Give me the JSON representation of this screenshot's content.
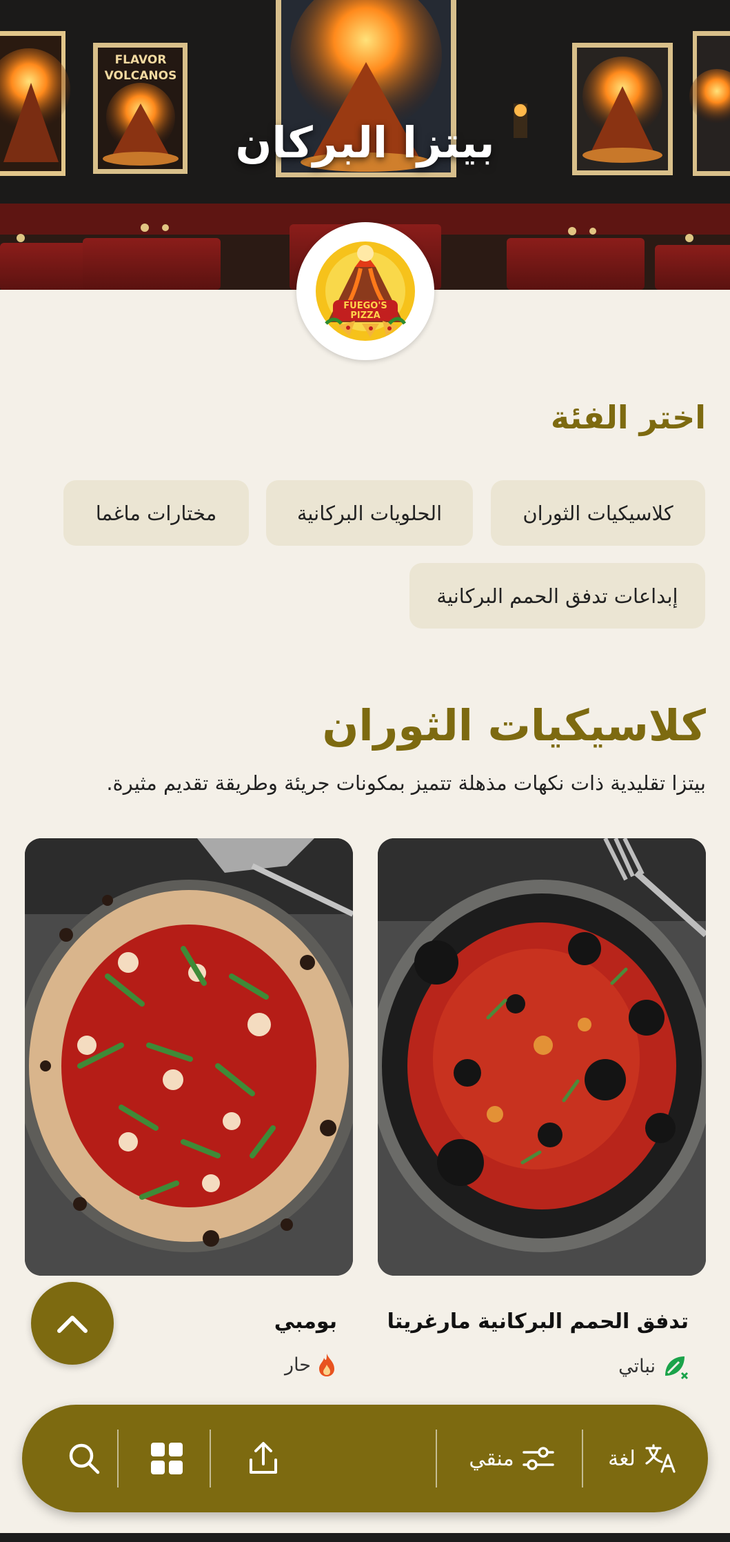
{
  "restaurant": {
    "name": "بيتزا البركان",
    "logo_text": "FUEGO'S PIZZA",
    "poster_text": "FLAVOR VOLCANOS"
  },
  "categories": {
    "heading": "اختر الفئة",
    "items": [
      {
        "label": "كلاسيكيات الثوران"
      },
      {
        "label": "الحلويات البركانية"
      },
      {
        "label": "مختارات ماغما"
      },
      {
        "label": "إبداعات تدفق الحمم البركانية"
      }
    ]
  },
  "section": {
    "title": "كلاسيكيات الثوران",
    "description": "بيتزا تقليدية ذات نكهات مذهلة تتميز بمكونات جريئة وطريقة تقديم مثيرة."
  },
  "products": [
    {
      "name": "تدفق الحمم البركانية مارغريتا",
      "tag": "نباتي",
      "tag_icon": "vegetarian-leaf-icon",
      "tag_color": "#1aa34a"
    },
    {
      "name": "بومبي",
      "tag": "حار",
      "tag_icon": "fire-icon",
      "tag_color": "#e8531f"
    }
  ],
  "bottom_bar": {
    "language_label": "لغة",
    "filter_label": "منقي",
    "icons": [
      "translate-icon",
      "filter-sliders-icon",
      "share-icon",
      "grid-icon",
      "search-icon"
    ]
  },
  "theme": {
    "accent": "#7d6a10",
    "background": "#f4f0e8",
    "chip_background": "#ebe5d3"
  }
}
